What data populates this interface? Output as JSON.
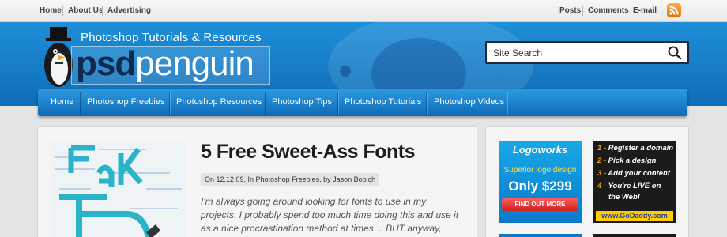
{
  "topbar": {
    "left_links": [
      "Home",
      "About Us",
      "Advertising"
    ],
    "right_links": [
      "Posts",
      "Comments",
      "E-mail"
    ],
    "rss_icon": "rss-icon"
  },
  "header": {
    "tagline": "Photoshop Tutorials & Resources",
    "logo_psd": "psd",
    "logo_penguin": "penguin",
    "accent_color": "#1478c5"
  },
  "search": {
    "placeholder": "Site Search",
    "icon": "search-icon"
  },
  "nav": {
    "items": [
      "Home",
      "Photoshop Freebies",
      "Photoshop Resources",
      "Photoshop Tips",
      "Photoshop Tutorials",
      "Photoshop Videos"
    ]
  },
  "post": {
    "title": "5 Free Sweet-Ass Fonts",
    "meta": "On 12.12.09, In Photoshop Freebies, by Jason Bobich",
    "excerpt": "I'm always going around looking for fonts to use in my projects. I probably spend too much time doing this and use it as a nice procrastination method at times… BUT anyway, these are currently"
  },
  "ads": {
    "logoworks": {
      "brand": "Logoworks",
      "line1": "Superior logo design",
      "price": "Only $299",
      "button": "FIND OUT MORE"
    },
    "godaddy": {
      "steps": [
        {
          "num": "1 -",
          "text": "Register a domain"
        },
        {
          "num": "2 -",
          "text": "Pick a design"
        },
        {
          "num": "3 -",
          "text": "Add your content"
        },
        {
          "num": "4 -",
          "text": "You're LIVE on"
        },
        {
          "num": "",
          "text": "the Web!"
        }
      ],
      "url": "www.GoDaddy.com"
    }
  }
}
